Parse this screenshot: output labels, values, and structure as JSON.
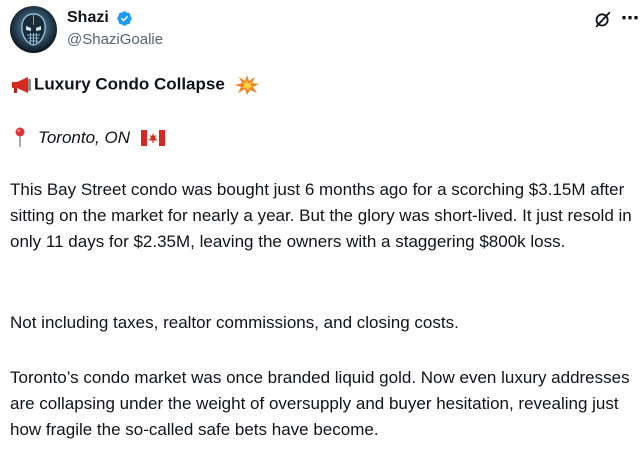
{
  "post": {
    "author": {
      "display_name": "Shazi",
      "handle": "@ShaziGoalie",
      "verified": true,
      "avatar_icon": "goalie-mask-avatar"
    },
    "header_icons": [
      "grok-icon",
      "more-icon"
    ],
    "title": "Luxury Condo Collapse",
    "title_emojis": [
      "megaphone-icon",
      "collision-icon"
    ],
    "location": "Toronto, ON",
    "location_emojis": [
      "round-pushpin-icon",
      "canada-flag-icon"
    ],
    "paragraphs": [
      "This Bay Street condo was bought just 6 months ago for a scorching $3.15M after sitting on the market for nearly a year. But the glory was short-lived. It just resold in only 11 days for $2.35M, leaving the owners with a staggering $800k loss.",
      "Not including taxes, realtor commissions, and closing costs.",
      "Toronto’s condo market was once branded liquid gold. Now even luxury addresses are collapsing under the weight of oversupply and buyer hesitation, revealing just how fragile the so-called safe bets have become."
    ]
  },
  "colors": {
    "text": "#0f1419",
    "secondary": "#536471",
    "verified": "#1d9bf0",
    "flag_red": "#d52b1e"
  }
}
